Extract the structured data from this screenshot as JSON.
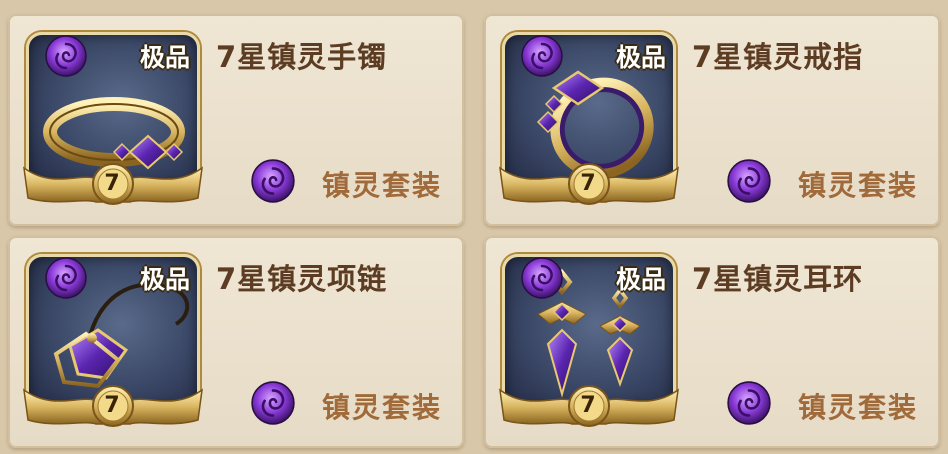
{
  "items": [
    {
      "name": "7星镇灵手镯",
      "grade": "极品",
      "stars": "7",
      "set_label": "镇灵套装",
      "art": "bracelet-icon"
    },
    {
      "name": "7星镇灵戒指",
      "grade": "极品",
      "stars": "7",
      "set_label": "镇灵套装",
      "art": "ring-icon"
    },
    {
      "name": "7星镇灵项链",
      "grade": "极品",
      "stars": "7",
      "set_label": "镇灵套装",
      "art": "necklace-icon"
    },
    {
      "name": "7星镇灵耳环",
      "grade": "极品",
      "stars": "7",
      "set_label": "镇灵套装",
      "art": "earrings-icon"
    }
  ],
  "colors": {
    "name": "#5c3c22",
    "set_label": "#a06a3a",
    "gem": "#6a2fc0",
    "gold": "#d8b560"
  }
}
